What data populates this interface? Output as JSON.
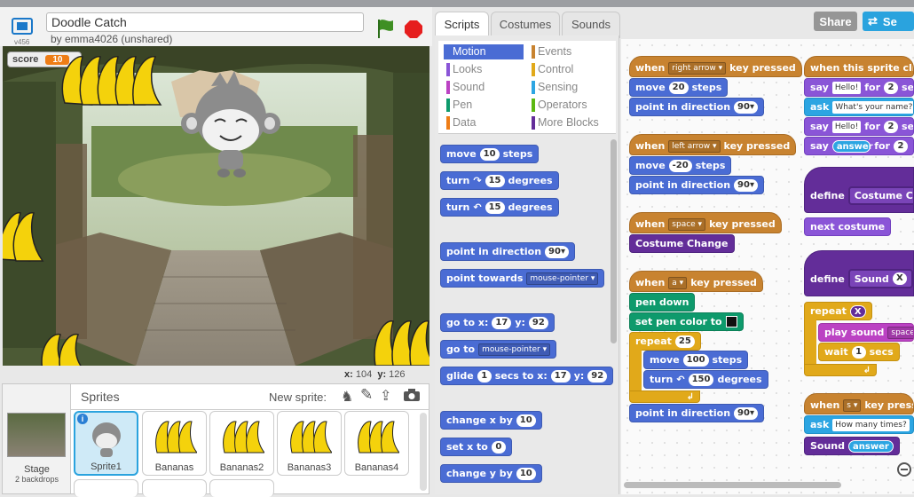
{
  "project": {
    "title": "Doodle Catch",
    "author": "by emma4026 (unshared)",
    "version": "v456"
  },
  "stage": {
    "score_label": "score",
    "score_value": "10",
    "x_label": "x:",
    "x_value": "104",
    "y_label": "y:",
    "y_value": "126"
  },
  "sprites_panel": {
    "header": "Sprites",
    "new_sprite": "New sprite:",
    "stage_label": "Stage",
    "stage_sub": "2 backdrops",
    "sprites": [
      "Sprite1",
      "Bananas",
      "Bananas2",
      "Bananas3",
      "Bananas4"
    ]
  },
  "tabs": {
    "scripts": "Scripts",
    "costumes": "Costumes",
    "sounds": "Sounds"
  },
  "top": {
    "share": "Share",
    "seeinside": "Se"
  },
  "categories": [
    {
      "label": "Motion",
      "color": "#4a6cd4"
    },
    {
      "label": "Events",
      "color": "#c88330"
    },
    {
      "label": "Looks",
      "color": "#8a55d7"
    },
    {
      "label": "Control",
      "color": "#e1a91a"
    },
    {
      "label": "Sound",
      "color": "#bb42c3"
    },
    {
      "label": "Sensing",
      "color": "#2ca5e2"
    },
    {
      "label": "Pen",
      "color": "#0e9a6c"
    },
    {
      "label": "Operators",
      "color": "#5cb712"
    },
    {
      "label": "Data",
      "color": "#ee7d16"
    },
    {
      "label": "More Blocks",
      "color": "#632d99"
    }
  ],
  "palette": {
    "move": "move",
    "move_n": "10",
    "steps": "steps",
    "turn": "turn",
    "turn_n": "15",
    "degrees": "degrees",
    "point_dir": "point in direction",
    "dir_n": "90▾",
    "point_towards": "point towards",
    "mouse": "mouse-pointer ▾",
    "goto": "go to x:",
    "gx": "17",
    "y": "y:",
    "gy": "92",
    "goto2": "go to",
    "glide": "glide",
    "g1": "1",
    "secs_to_x": "secs to x:",
    "change_x": "change x by",
    "cx": "10",
    "set_x": "set x to",
    "sx": "0",
    "change_y": "change y by",
    "cy": "10"
  },
  "scripts": {
    "when": "when",
    "key_pressed": "key pressed",
    "right_arrow": "right arrow ▾",
    "left_arrow": "left arrow ▾",
    "space": "space ▾",
    "a": "a ▾",
    "s": "s ▾",
    "move": "move",
    "steps": "steps",
    "m20": "20",
    "mneg20": "-20",
    "m100": "100",
    "point_dir": "point in direction",
    "d90": "90▾",
    "costume_change": "Costume Change",
    "pen_down": "pen down",
    "set_pen": "set pen color to",
    "repeat": "repeat",
    "r25": "25",
    "turn": "turn",
    "t150": "150",
    "degrees": "degrees",
    "when_clicked": "when this sprite clic",
    "say": "say",
    "hello": "Hello!",
    "for": "for",
    "two": "2",
    "sec": "sec",
    "ask": "ask",
    "whats_name": "What's your name?",
    "answer": "answer",
    "define": "define",
    "costume_ch": "Costume Ch",
    "next_costume": "next costume",
    "sound": "Sound",
    "xvar": "X",
    "play_sound": "play sound",
    "space_snd": "space u",
    "wait": "wait",
    "w1": "1",
    "secs": "secs",
    "when_s": "when",
    "key_press": "key press",
    "how_many": "How many times?"
  }
}
